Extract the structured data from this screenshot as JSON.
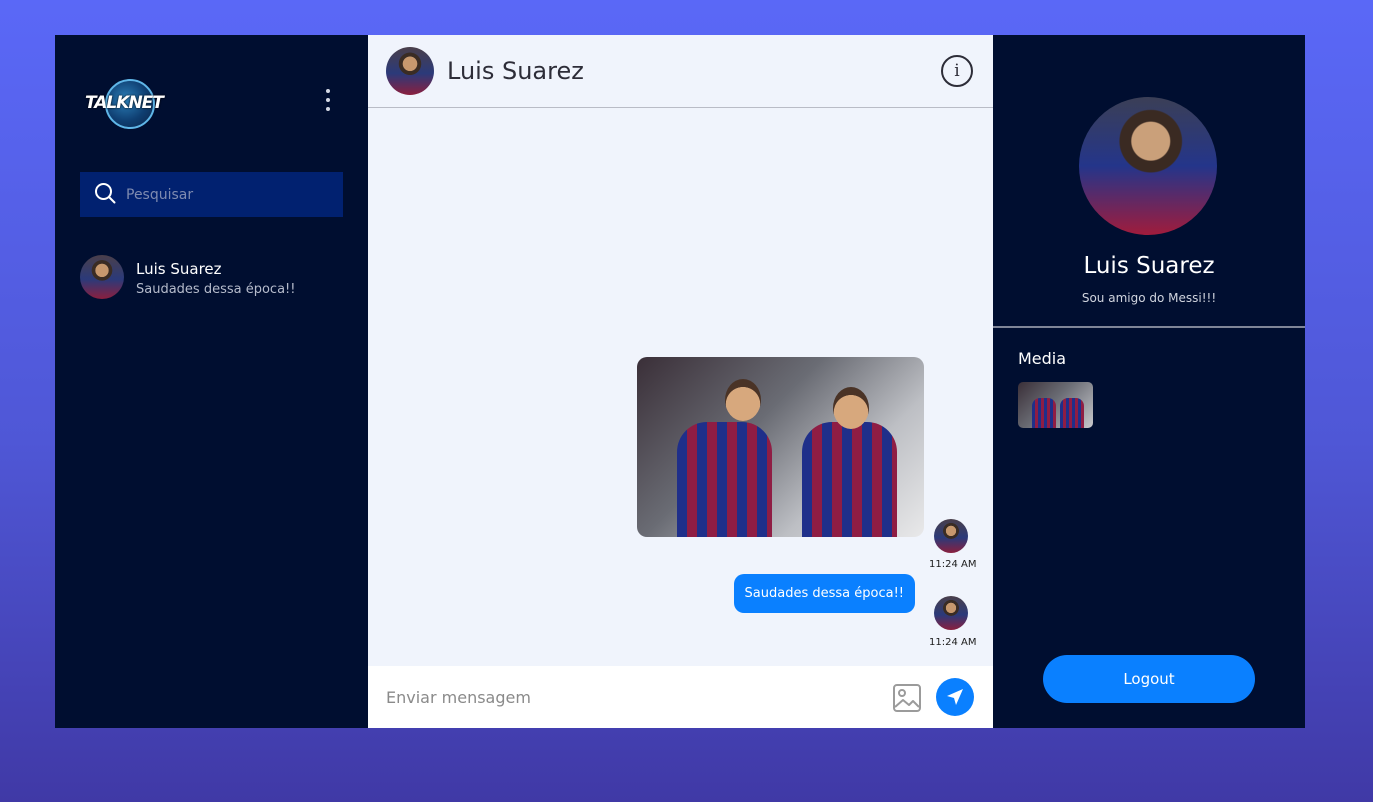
{
  "brand": {
    "logo_text": "TALKNET"
  },
  "sidebar": {
    "search": {
      "placeholder": "Pesquisar"
    },
    "contacts": [
      {
        "name": "Luis Suarez",
        "last_message": "Saudades dessa época!!"
      }
    ]
  },
  "chat": {
    "header": {
      "title": "Luis Suarez"
    },
    "messages": [
      {
        "type": "image",
        "time": "11:24 AM"
      },
      {
        "type": "text",
        "text": "Saudades dessa época!!",
        "time": "11:24 AM"
      }
    ],
    "composer": {
      "placeholder": "Enviar mensagem"
    }
  },
  "profile": {
    "name": "Luis Suarez",
    "bio": "Sou amigo do Messi!!!",
    "media_title": "Media",
    "logout_label": "Logout"
  },
  "colors": {
    "background_top": "#5a68f7",
    "background_bottom": "#4039a6",
    "panel_dark": "#000e30",
    "search_bg": "#012170",
    "chat_bg": "#f0f4fc",
    "accent": "#0a80ff"
  },
  "icons": {
    "logo": "talknet-logo-icon",
    "menu": "kebab-menu-icon",
    "search": "search-icon",
    "info": "info-icon",
    "image": "image-icon",
    "send": "send-icon"
  }
}
